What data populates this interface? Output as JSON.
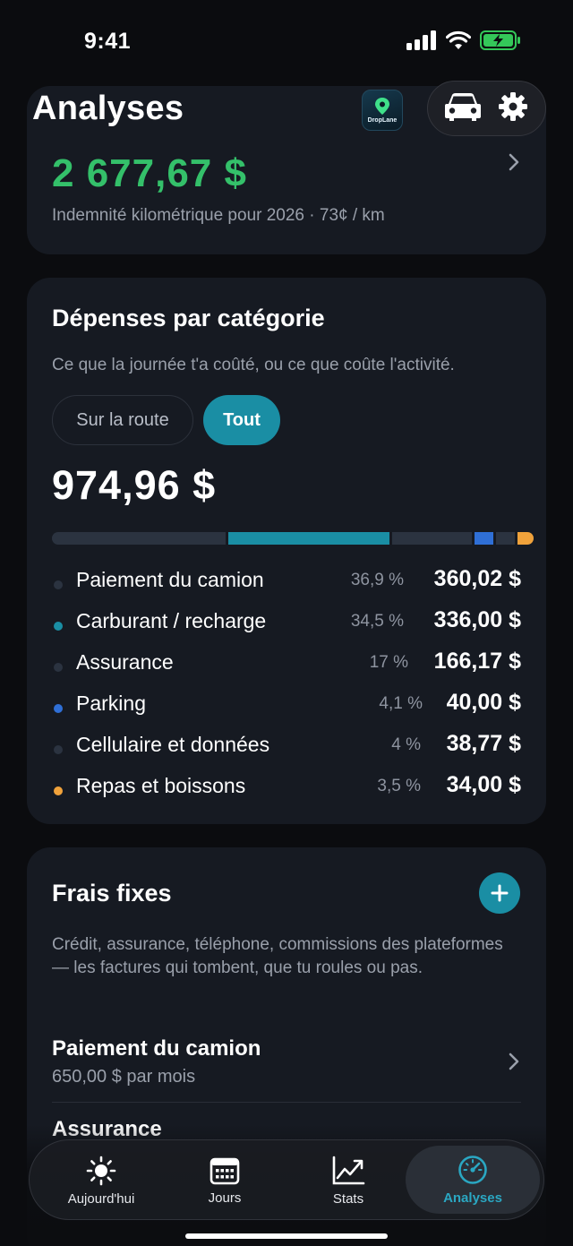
{
  "status": {
    "time": "9:41"
  },
  "header": {
    "title": "Analyses",
    "logo_text": "DropLane"
  },
  "mileage": {
    "amount": "2 677,67 $",
    "subtitle": "Indemnité kilométrique pour 2026 · 73¢ / km"
  },
  "expenses": {
    "title": "Dépenses par catégorie",
    "description": "Ce que la journée t'a coûté, ou ce que coûte l'activité.",
    "filter_road": "Sur la route",
    "filter_all": "Tout",
    "total": "974,96 $",
    "items": [
      {
        "label": "Paiement du camion",
        "pct": "36,9 %",
        "amount": "360,02 $",
        "color": "#2b3340"
      },
      {
        "label": "Carburant / recharge",
        "pct": "34,5 %",
        "amount": "336,00 $",
        "color": "#1a8ea4"
      },
      {
        "label": "Assurance",
        "pct": "17 %",
        "amount": "166,17 $",
        "color": "#2b3340"
      },
      {
        "label": "Parking",
        "pct": "4,1 %",
        "amount": "40,00 $",
        "color": "#2f6fd6"
      },
      {
        "label": "Cellulaire et données",
        "pct": "4 %",
        "amount": "38,77 $",
        "color": "#2b3340"
      },
      {
        "label": "Repas et boissons",
        "pct": "3,5 %",
        "amount": "34,00 $",
        "color": "#f0a23b"
      }
    ]
  },
  "fixed": {
    "title": "Frais fixes",
    "description": "Crédit, assurance, téléphone, commissions des plateformes — les factures qui tombent, que tu roules ou pas.",
    "items": [
      {
        "title": "Paiement du camion",
        "sub": "650,00 $ par mois"
      },
      {
        "title": "Assurance",
        "sub": ""
      }
    ]
  },
  "tabs": {
    "today": "Aujourd'hui",
    "days": "Jours",
    "stats": "Stats",
    "analyses": "Analyses"
  },
  "colors": {
    "accent": "#1a8ea4",
    "green": "#34c06a",
    "card": "#161a22"
  }
}
